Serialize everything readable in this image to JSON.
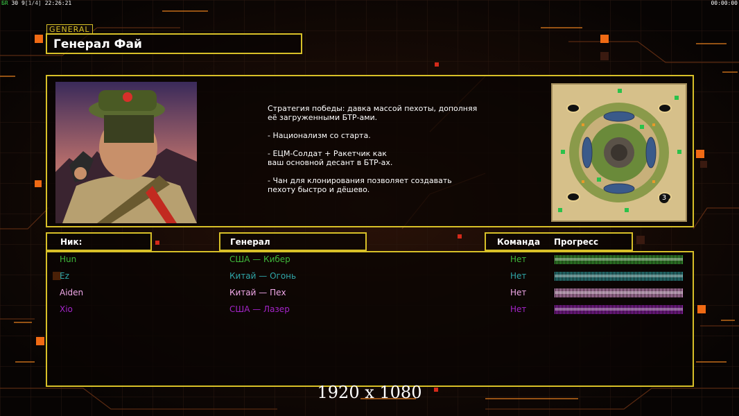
{
  "hud": {
    "left_label": "БR",
    "left_a": "30",
    "left_b": "9",
    "left_c": "[1/4]",
    "left_time": "22:26:21",
    "right_time": "00:00:00"
  },
  "general_tag": "GENERAL",
  "general_name": "Генерал Фай",
  "description": [
    "Стратегия победы: давка массой пехоты, дополняя\n её загруженными БТР-ами.",
    "- Национализм со старта.",
    "- ЕЦМ-Солдат + Ракетчик как\nваш основной десант в БТР-ах.",
    "- Чан для клонирования позволяет создавать\n пехоту быстро и дёшево."
  ],
  "minimap": {
    "player_count_label": "3"
  },
  "columns": {
    "nick": "Ник:",
    "general": "Генерал",
    "team": "Команда",
    "progress": "Прогресс"
  },
  "players": [
    {
      "nick": "Hun",
      "general": "США — Кибер",
      "team": "Нет",
      "progress": 1.0,
      "color": "#3fb83a"
    },
    {
      "nick": "Ez",
      "general": "Китай — Огонь",
      "team": "Нет",
      "progress": 1.0,
      "color": "#2fa6a8"
    },
    {
      "nick": "Aiden",
      "general": "Китай — Пех",
      "team": "Нет",
      "progress": 1.0,
      "color": "#f0a8e8"
    },
    {
      "nick": "Xio",
      "general": "США — Лазер",
      "team": "Нет",
      "progress": 1.0,
      "color": "#a424c8"
    }
  ],
  "resolution": "1920 x 1080",
  "colors": {
    "frame": "#d8c028",
    "accent": "#f06a14"
  }
}
